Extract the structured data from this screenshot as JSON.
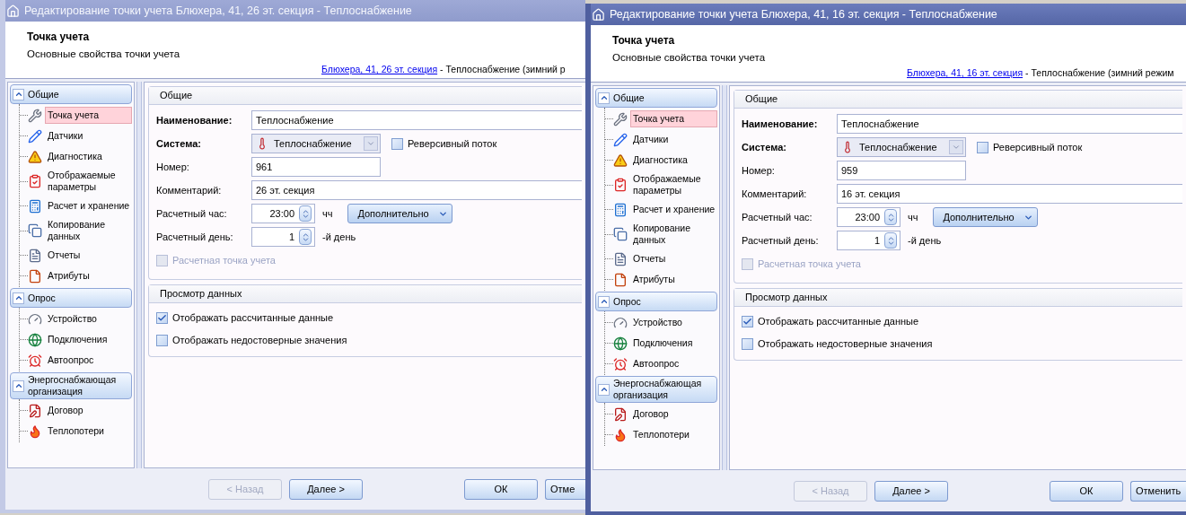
{
  "windows": [
    {
      "active": false,
      "title": "Редактирование точки учета Блюхера, 41, 26 эт. секция - Теплоснабжение",
      "header": {
        "title": "Точка учета",
        "subtitle": "Основные свойства точки учета",
        "link": "Блюхера, 41, 26 эт. секция",
        "link_suffix": "- Теплоснабжение (зимний р"
      },
      "sidebar": [
        {
          "label": "Общие",
          "expanded": true,
          "items": [
            {
              "label": "Точка учета",
              "selected": true
            },
            {
              "label": "Датчики",
              "selected": false
            },
            {
              "label": "Диагностика",
              "selected": false
            },
            {
              "label": "Отображаемые параметры",
              "selected": false
            },
            {
              "label": "Расчет и хранение",
              "selected": false
            },
            {
              "label": "Копирование данных",
              "selected": false
            },
            {
              "label": "Отчеты",
              "selected": false
            },
            {
              "label": "Атрибуты",
              "selected": false
            }
          ]
        },
        {
          "label": "Опрос",
          "expanded": true,
          "items": [
            {
              "label": "Устройство",
              "selected": false
            },
            {
              "label": "Подключения",
              "selected": false
            },
            {
              "label": "Автоопрос",
              "selected": false
            }
          ]
        },
        {
          "label": "Энергоснабжающая организация",
          "expanded": true,
          "items": [
            {
              "label": "Договор",
              "selected": false
            },
            {
              "label": "Теплопотери",
              "selected": false
            }
          ]
        }
      ],
      "general": {
        "title": "Общие",
        "name_label": "Наименование:",
        "name_value": "Теплоснабжение",
        "system_label": "Система:",
        "system_value": "Теплоснабжение",
        "reverse": {
          "label": "Реверсивный поток",
          "checked": false
        },
        "number_label": "Номер:",
        "number_value": "961",
        "comment_label": "Комментарий:",
        "comment_value": "26 эт. секция",
        "hour_label": "Расчетный час:",
        "hour_value": "23:00",
        "hour_unit": "чч",
        "more_button": "Дополнительно",
        "day_label": "Расчетный день:",
        "day_value": "1",
        "day_unit": "-й день",
        "calc_point": {
          "label": "Расчетная точка учета",
          "checked": false,
          "disabled": true
        }
      },
      "data_view": {
        "title": "Просмотр данных",
        "options": [
          {
            "label": "Отображать рассчитанные данные",
            "checked": true
          },
          {
            "label": "Отображать недостоверные значения",
            "checked": false
          }
        ]
      },
      "buttons": [
        {
          "label": "< Назад",
          "disabled": true
        },
        {
          "label": "Далее >",
          "disabled": false
        },
        {
          "label": "ОК",
          "disabled": false
        },
        {
          "label": "Отме",
          "disabled": false
        }
      ]
    },
    {
      "active": true,
      "title": "Редактирование точки учета Блюхера, 41, 16 эт. секция - Теплоснабжение",
      "header": {
        "title": "Точка учета",
        "subtitle": "Основные свойства точки учета",
        "link": "Блюхера, 41, 16 эт. секция",
        "link_suffix": "- Теплоснабжение (зимний режим"
      },
      "sidebar": [
        {
          "label": "Общие",
          "expanded": true,
          "items": [
            {
              "label": "Точка учета",
              "selected": true
            },
            {
              "label": "Датчики",
              "selected": false
            },
            {
              "label": "Диагностика",
              "selected": false
            },
            {
              "label": "Отображаемые параметры",
              "selected": false
            },
            {
              "label": "Расчет и хранение",
              "selected": false
            },
            {
              "label": "Копирование данных",
              "selected": false
            },
            {
              "label": "Отчеты",
              "selected": false
            },
            {
              "label": "Атрибуты",
              "selected": false
            }
          ]
        },
        {
          "label": "Опрос",
          "expanded": true,
          "items": [
            {
              "label": "Устройство",
              "selected": false
            },
            {
              "label": "Подключения",
              "selected": false
            },
            {
              "label": "Автоопрос",
              "selected": false
            }
          ]
        },
        {
          "label": "Энергоснабжающая организация",
          "expanded": true,
          "items": [
            {
              "label": "Договор",
              "selected": false
            },
            {
              "label": "Теплопотери",
              "selected": false
            }
          ]
        }
      ],
      "general": {
        "title": "Общие",
        "name_label": "Наименование:",
        "name_value": "Теплоснабжение",
        "system_label": "Система:",
        "system_value": "Теплоснабжение",
        "reverse": {
          "label": "Реверсивный поток",
          "checked": false
        },
        "number_label": "Номер:",
        "number_value": "959",
        "comment_label": "Комментарий:",
        "comment_value": "16 эт. секция",
        "hour_label": "Расчетный час:",
        "hour_value": "23:00",
        "hour_unit": "чч",
        "more_button": "Дополнительно",
        "day_label": "Расчетный день:",
        "day_value": "1",
        "day_unit": "-й день",
        "calc_point": {
          "label": "Расчетная точка учета",
          "checked": false,
          "disabled": true
        }
      },
      "data_view": {
        "title": "Просмотр данных",
        "options": [
          {
            "label": "Отображать рассчитанные данные",
            "checked": true
          },
          {
            "label": "Отображать недостоверные значения",
            "checked": false
          }
        ]
      },
      "buttons": [
        {
          "label": "< Назад",
          "disabled": true
        },
        {
          "label": "Далее >",
          "disabled": false
        },
        {
          "label": "ОК",
          "disabled": false
        },
        {
          "label": "Отменить",
          "disabled": false
        }
      ]
    }
  ]
}
